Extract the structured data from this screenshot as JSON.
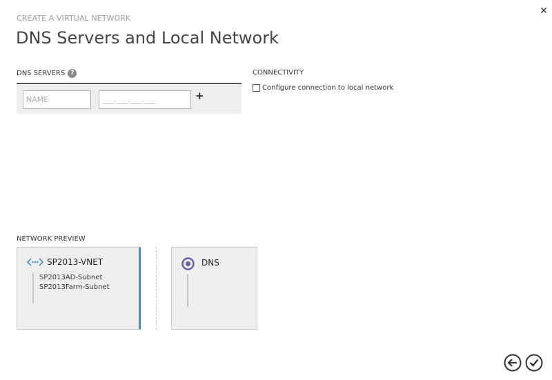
{
  "header": {
    "subtitle": "CREATE A VIRTUAL NETWORK",
    "title": "DNS Servers and Local Network",
    "close_icon": "close-icon"
  },
  "dns_servers": {
    "label": "DNS SERVERS",
    "help_glyph": "?",
    "name_placeholder": "NAME",
    "name_value": "",
    "ip_placeholder": "___.___.___.___",
    "ip_value": "",
    "add_glyph": "+"
  },
  "connectivity": {
    "label": "CONNECTIVITY",
    "checkbox_label": "Configure connection to local network",
    "checked": false
  },
  "network_preview": {
    "label": "NETWORK PREVIEW",
    "vnet_name": "SP2013-VNET",
    "subnets": [
      "SP2013AD-Subnet",
      "SP2013Farm-Subnet"
    ],
    "dns_label": "DNS"
  },
  "footer": {
    "back_icon": "back-arrow-icon",
    "confirm_icon": "checkmark-icon"
  },
  "colors": {
    "accent_blue": "#3d8dd3",
    "dns_purple": "#6b5ea8",
    "panel_gray": "#eeeeee"
  }
}
